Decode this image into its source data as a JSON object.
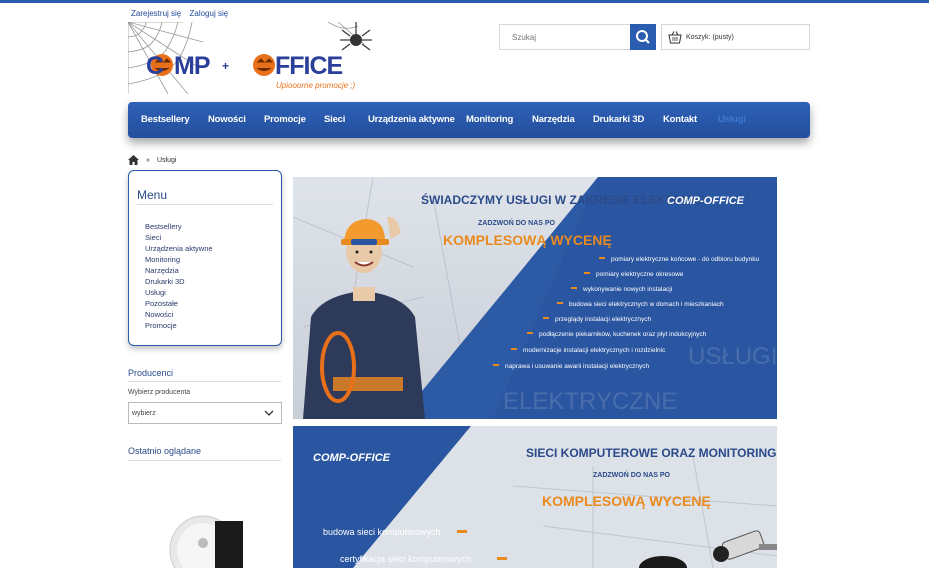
{
  "header": {
    "register_label": "Zarejestruj się",
    "login_label": "Zaloguj się",
    "logo_text": "COMP OFFICE",
    "logo_tagline": "Upiooorne promocje ;)"
  },
  "search": {
    "placeholder": "Szukaj"
  },
  "cart": {
    "label": "Koszyk: (pusty)"
  },
  "nav": {
    "items": [
      "Bestsellery",
      "Nowości",
      "Promocje",
      "Sieci",
      "Urządzenia aktywne",
      "Monitoring",
      "Narzędzia",
      "Drukarki 3D",
      "Kontakt",
      "Usługi"
    ],
    "active": "Usługi"
  },
  "breadcrumb": {
    "separator": "»",
    "current": "Usługi"
  },
  "sidebar": {
    "menu_title": "Menu",
    "menu_items": [
      "Bestsellery",
      "Sieci",
      "Urządzenia aktywne",
      "Monitoring",
      "Narzędzia",
      "Drukarki 3D",
      "Usługi",
      "Pozostałe",
      "Nowości",
      "Promocje"
    ],
    "producers_title": "Producenci",
    "producer_label": "Wybierz producenta",
    "producer_selected": "wybierz",
    "recent_title": "Ostatnio oglądane"
  },
  "banner1": {
    "title": "ŚWIADCZYMY USŁUGI W ZAKRESIE ELEKTRYKI!",
    "brand": "COMP-OFFICE",
    "call": "ZADZWOŃ DO NAS PO",
    "highlight": "KOMPLESOWĄ WYCENĘ",
    "services": [
      "pomiary elektryczne końcowe - do odbioru budynku",
      "pomiary elektryczne okresowe",
      "wykonywanie nowych instalacji",
      "budowa sieci elektrycznych w domach i mieszkaniach",
      "przeglądy instalacji elektrycznych",
      "podłączenie piekarników, kuchenek oraz płyt indukcyjnych",
      "modernizacje instalacji elektrycznych i rozdzielnic",
      "naprawa i usuwanie awarii instalacji elektrycznych"
    ],
    "watermark1": "USŁUGI",
    "watermark2": "ELEKTRYCZNE"
  },
  "banner2": {
    "brand": "COMP-OFFICE",
    "title": "SIECI KOMPUTEROWE ORAZ MONITORING",
    "call": "ZADZWOŃ DO NAS PO",
    "highlight": "KOMPLESOWĄ WYCENĘ",
    "services": [
      "budowa sieci komputerowych",
      "certyfikacja sieci komputerowych"
    ]
  },
  "colors": {
    "primary": "#2a5db0",
    "nav_active": "#3e78cf",
    "accent_orange": "#e98a1f"
  }
}
